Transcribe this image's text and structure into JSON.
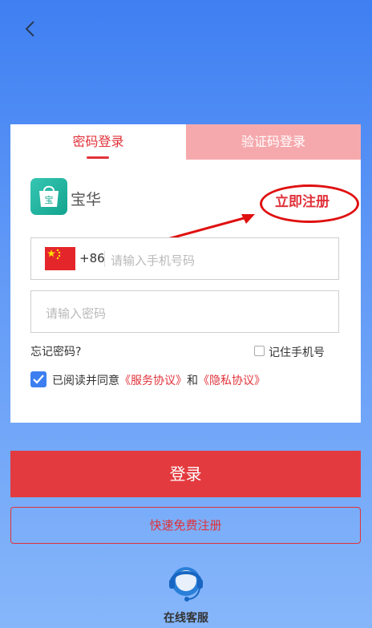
{
  "nav": {
    "back_icon": "chevron-left-icon"
  },
  "tabs": {
    "password_login": "密码登录",
    "sms_login": "验证码登录"
  },
  "brand": {
    "logo_char": "宝",
    "name": "宝华"
  },
  "register_link": "立即注册",
  "phone": {
    "country_code": "+86",
    "placeholder": "请输入手机号码",
    "flag_icon": "china-flag-icon"
  },
  "password": {
    "placeholder": "请输入密码"
  },
  "forgot_password": "忘记密码?",
  "remember_phone": {
    "label": "记住手机号",
    "checked": false
  },
  "agreement": {
    "checked": true,
    "prefix": "已阅读并同意",
    "service": "《服务协议》",
    "and": "和",
    "privacy": "《隐私协议》"
  },
  "buttons": {
    "login": "登录",
    "quick_register": "快速免费注册"
  },
  "support": {
    "label": "在线客服",
    "icon": "customer-service-icon"
  },
  "colors": {
    "accent": "#e0323a",
    "tab_inactive_bg": "#f6a9ad",
    "check": "#3d7ff0",
    "brand": "#1fb39f"
  }
}
